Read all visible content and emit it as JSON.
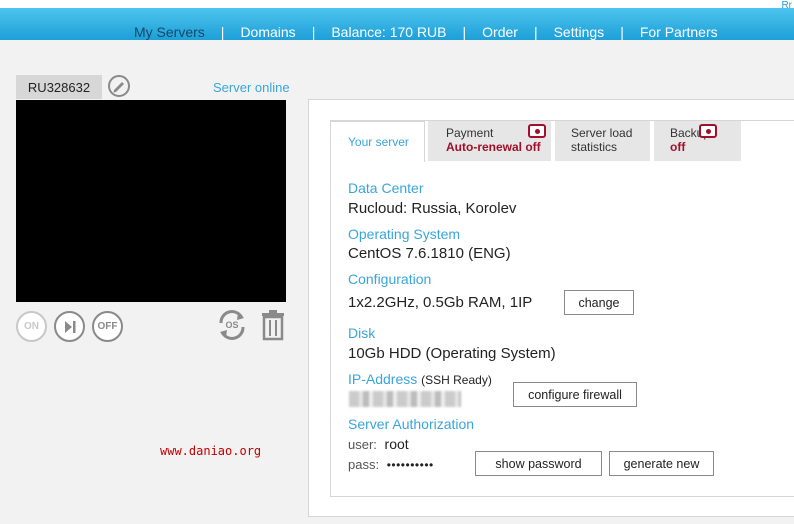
{
  "nav": {
    "items": [
      "My Servers",
      "Domains",
      "Balance: 170 RUB",
      "Order",
      "Settings",
      "For Partners"
    ],
    "corner": "Rr"
  },
  "server": {
    "id": "RU328632",
    "status": "Server online"
  },
  "controls": {
    "on": "ON",
    "off": "OFF",
    "os": "OS"
  },
  "watermark": "www.daniao.org",
  "tabs": {
    "your_server": "Your server",
    "payment": "Payment",
    "payment_state": "Auto-renewal off",
    "load_1": "Server load",
    "load_2": "statistics",
    "backup": "Backup",
    "backup_state": "off"
  },
  "details": {
    "dc_label": "Data Center",
    "dc_value": "Rucloud: Russia, Korolev",
    "os_label": "Operating System",
    "os_value": "CentOS 7.6.1810 (ENG)",
    "config_label": "Configuration",
    "config_value": "1x2.2GHz, 0.5Gb RAM, 1IP",
    "change_button": "change",
    "disk_label": "Disk",
    "disk_value": "10Gb HDD (Operating System)",
    "ip_label": "IP-Address",
    "ip_note": "(SSH Ready)",
    "firewall_button": "configure firewall",
    "auth_label": "Server Authorization",
    "user_label": "user:",
    "user_value": "root",
    "pass_label": "pass:",
    "pass_value": "••••••••••",
    "show_password_button": "show password",
    "generate_button": "generate new"
  },
  "colors": {
    "accent": "#3aa5dc",
    "nav_top": "#4ec4ee",
    "nav_bottom": "#1d9fd8",
    "alert": "#a0102a"
  }
}
